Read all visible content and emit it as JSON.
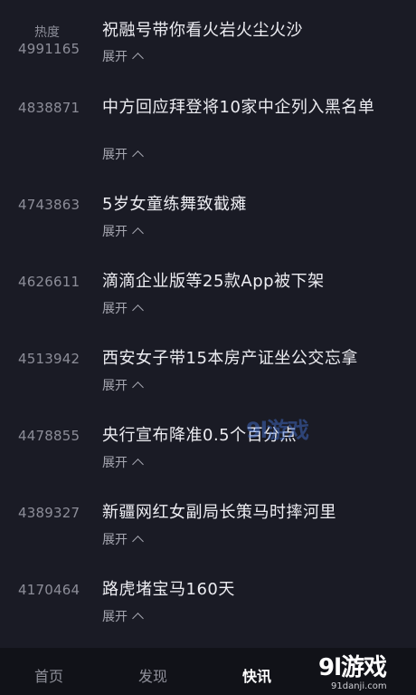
{
  "header": {
    "heat_label": "热度"
  },
  "items": [
    {
      "score": "4991165",
      "title": "祝融号带你看火岩火尘火沙",
      "expand": "展开"
    },
    {
      "score": "4838871",
      "title": "中方回应拜登将10家中企列入黑名单",
      "expand": "展开"
    },
    {
      "score": "4743863",
      "title": "5岁女童练舞致截瘫",
      "expand": "展开"
    },
    {
      "score": "4626611",
      "title": "滴滴企业版等25款App被下架",
      "expand": "展开"
    },
    {
      "score": "4513942",
      "title": "西安女子带15本房产证坐公交忘拿",
      "expand": "展开"
    },
    {
      "score": "4478855",
      "title": "央行宣布降准0.5个百分点",
      "expand": "展开"
    },
    {
      "score": "4389327",
      "title": "新疆网红女副局长策马时摔河里",
      "expand": "展开"
    },
    {
      "score": "4170464",
      "title": "路虎堵宝马160天",
      "expand": "展开"
    }
  ],
  "nav": {
    "tabs": [
      {
        "label": "首页"
      },
      {
        "label": "发现"
      },
      {
        "label": "快讯",
        "active": true
      }
    ]
  },
  "watermark": {
    "center": "9l游戏",
    "logo": "9l游戏",
    "url": "91danji.com"
  }
}
